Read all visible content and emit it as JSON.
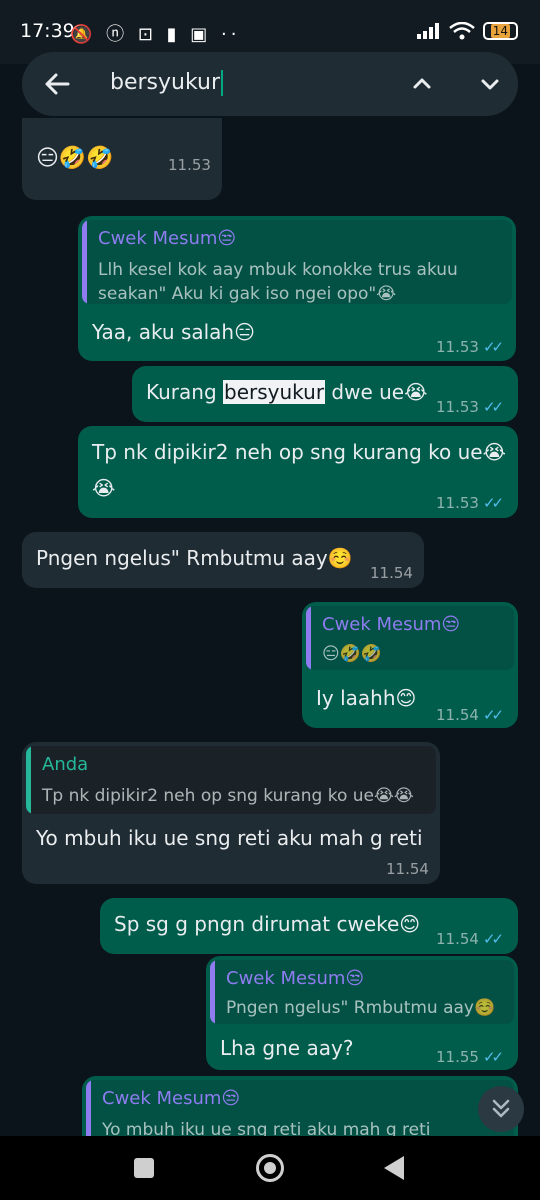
{
  "status_bar": {
    "time": "17:39",
    "left_icons": "🔕 ⓝ ⊡ ▮ ▣ ··",
    "battery": "14"
  },
  "search": {
    "query": "bersyukur"
  },
  "colors": {
    "accent": "#00a884",
    "quote_author_purple": "#8e7cf0",
    "quote_author_green": "#25b89a",
    "ticks": "#53bdeb"
  },
  "messages": [
    {
      "dir": "in",
      "text": "😑🤣🤣",
      "time": "11.53"
    },
    {
      "dir": "out",
      "quote_author": "Cwek Mesum😒",
      "quote_text": [
        "Llh kesel kok aay mbuk konokke trus akuu",
        "seakan\" Aku ki gak iso ngei opo\"😭"
      ],
      "text": "Yaa, aku salah😑",
      "time": "11.53"
    },
    {
      "dir": "out",
      "text_before": "Kurang ",
      "highlight": "bersyukur",
      "text_after": " dwe ue😭",
      "time": "11.53"
    },
    {
      "dir": "out",
      "text_lines": [
        "Tp nk dipikir2 neh op sng kurang ko ue😭",
        "😭"
      ],
      "time": "11.53"
    },
    {
      "dir": "in",
      "text": "Pngen ngelus\" Rmbutmu aay☺️",
      "time": "11.54"
    },
    {
      "dir": "out",
      "quote_author": "Cwek Mesum😒",
      "quote_text": [
        "😑🤣🤣"
      ],
      "text": "Iy laahh😊",
      "time": "11.54"
    },
    {
      "dir": "in",
      "quote_author": "Anda",
      "quote_text": [
        "Tp nk dipikir2 neh op sng kurang ko ue😭😭"
      ],
      "text": "Yo mbuh iku ue sng reti aku mah g reti",
      "time": "11.54"
    },
    {
      "dir": "out",
      "text": "Sp sg g pngn dirumat cweke😊",
      "time": "11.54"
    },
    {
      "dir": "out",
      "quote_author": "Cwek Mesum😒",
      "quote_text": [
        "Pngen ngelus\" Rmbutmu aay☺️"
      ],
      "text": "Lha gne aay?",
      "time": "11.55"
    },
    {
      "dir": "out",
      "quote_author": "Cwek Mesum😒",
      "quote_text": [
        "Yo mbuh iku ue sng reti aku mah g reti"
      ]
    }
  ]
}
